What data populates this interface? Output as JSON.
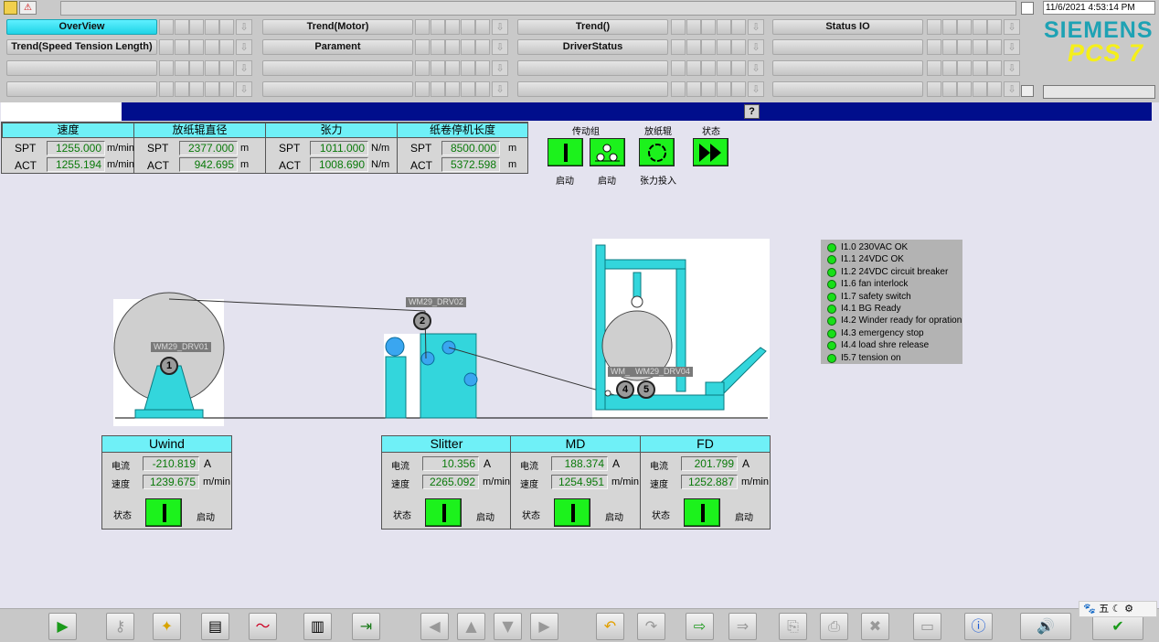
{
  "header": {
    "datetime": "11/6/2021 4:53:14 PM",
    "brand": "SIEMENS",
    "product": "PCS 7",
    "nav": [
      {
        "label": "OverView",
        "active": true
      },
      {
        "label": "Trend(Motor)"
      },
      {
        "label": "Trend()"
      },
      {
        "label": "Status IO"
      },
      {
        "label": "Trend(Speed Tension Length)"
      },
      {
        "label": "Parament"
      },
      {
        "label": "DriverStatus"
      }
    ]
  },
  "helpbutton": "?",
  "params": {
    "columns": [
      {
        "title": "速度",
        "spt": "1255.000",
        "act": "1255.194",
        "unit": "m/min"
      },
      {
        "title": "放纸辊直径",
        "spt": "2377.000",
        "act": "942.695",
        "unit": "m"
      },
      {
        "title": "张力",
        "spt": "1011.000",
        "act": "1008.690",
        "unit": "N/m"
      },
      {
        "title": "纸卷停机长度",
        "spt": "8500.000",
        "act": "5372.598",
        "unit": "m"
      }
    ],
    "spt_label": "SPT",
    "act_label": "ACT"
  },
  "drive_status": {
    "group_label": "传动组",
    "unwind_label": "放纸辊",
    "state_label": "状态",
    "start1": "启动",
    "start2": "启动",
    "tension_on": "张力投入"
  },
  "machine": {
    "tags": [
      "WM29_DRV01",
      "WM29_DRV02",
      "WM_",
      "WM29_DRV04"
    ],
    "numbers": [
      "1",
      "2",
      "4",
      "5"
    ]
  },
  "motors": [
    {
      "name": "Uwind",
      "current": "-210.819",
      "speed": "1239.675"
    },
    {
      "name": "Slitter",
      "current": "10.356",
      "speed": "2265.092"
    },
    {
      "name": "MD",
      "current": "188.374",
      "speed": "1254.951"
    },
    {
      "name": "FD",
      "current": "201.799",
      "speed": "1252.887"
    }
  ],
  "motor_labels": {
    "current": "电流",
    "speed": "速度",
    "state": "状态",
    "start": "启动",
    "unit_a": "A",
    "unit_speed": "m/min"
  },
  "io": [
    "I1.0 230VAC OK",
    "I1.1 24VDC OK",
    "I1.2 24VDC circuit breaker",
    "I1.6 fan interlock",
    "I1.7 safety switch",
    "I4.1 BG Ready",
    "I4.2 Winder ready for opration",
    "I4.3 emergency stop",
    "I4.4 load shre release",
    "I5.7 tension on"
  ],
  "ime": {
    "lang": "五"
  },
  "colors": {
    "accent": "#1fd3e6",
    "status_green": "#1cf21c",
    "header_blue": "#000e8c",
    "brand": "#1ea2b4",
    "pcs7": "#f5ef1a"
  }
}
